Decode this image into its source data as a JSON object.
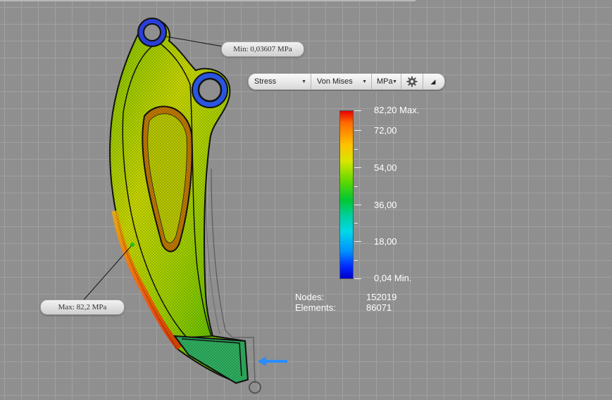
{
  "toolbar": {
    "result_type": "Stress",
    "component": "Von Mises",
    "unit": "MPa",
    "settings_icon": "gear-icon",
    "collapse_icon": "triangle-corner-icon"
  },
  "probes": {
    "min_label": "Min: 0,03607 MPa",
    "max_label": "Max: 82,2 MPa"
  },
  "legend": {
    "labels": [
      "82,20 Max.",
      "72,00",
      "54,00",
      "36,00",
      "18,00",
      "0,04 Min."
    ],
    "colors": [
      "#e80000",
      "#ffc000",
      "#60d800",
      "#00d8e8",
      "#0028ff",
      "#0000c8"
    ]
  },
  "stats": {
    "nodes_label": "Nodes:",
    "nodes_value": "152019",
    "elements_label": "Elements:",
    "elements_value": "86071"
  },
  "load_arrow": {
    "color": "#2a8cff",
    "icon": "load-arrow-icon"
  }
}
